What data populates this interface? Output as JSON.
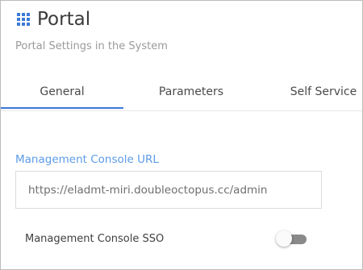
{
  "header": {
    "title": "Portal",
    "subtitle": "Portal Settings in the System",
    "icon": "grid-icon"
  },
  "tabs": [
    {
      "label": "General",
      "active": true
    },
    {
      "label": "Parameters",
      "active": false
    },
    {
      "label": "Self Service",
      "active": false
    }
  ],
  "form": {
    "management_console_url": {
      "label": "Management Console URL",
      "value": "https://eladmt-miri.doubleoctopus.cc/admin"
    },
    "management_console_sso": {
      "label": "Management Console SSO",
      "enabled": false
    }
  },
  "colors": {
    "accent": "#3d79d8",
    "label_blue": "#5c9be8",
    "toggle_off": "#8a8a8a"
  }
}
